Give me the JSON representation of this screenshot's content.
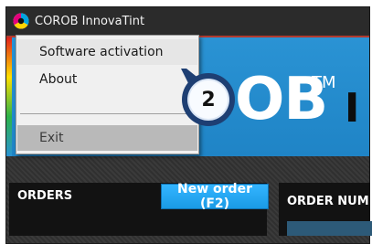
{
  "window": {
    "title": "COROB InnovaTint"
  },
  "banner": {
    "logo_text": "OB",
    "logo_tm": "TM",
    "logo_suffix": "I"
  },
  "menu": {
    "items": [
      {
        "label": "Software activation"
      },
      {
        "label": "About"
      },
      {
        "label": "Exit"
      }
    ]
  },
  "annotation": {
    "callout_number": "2"
  },
  "orders": {
    "label": "ORDERS",
    "new_order_button": "New order (F2)"
  },
  "order_number": {
    "label": "ORDER NUM"
  },
  "colors": {
    "banner_blue": "#2a93d4",
    "button_blue": "#1a9be6",
    "titlebar": "#2b2b2b",
    "menu_bg": "#f0f0f0",
    "callout_ring": "#1e3f73"
  }
}
